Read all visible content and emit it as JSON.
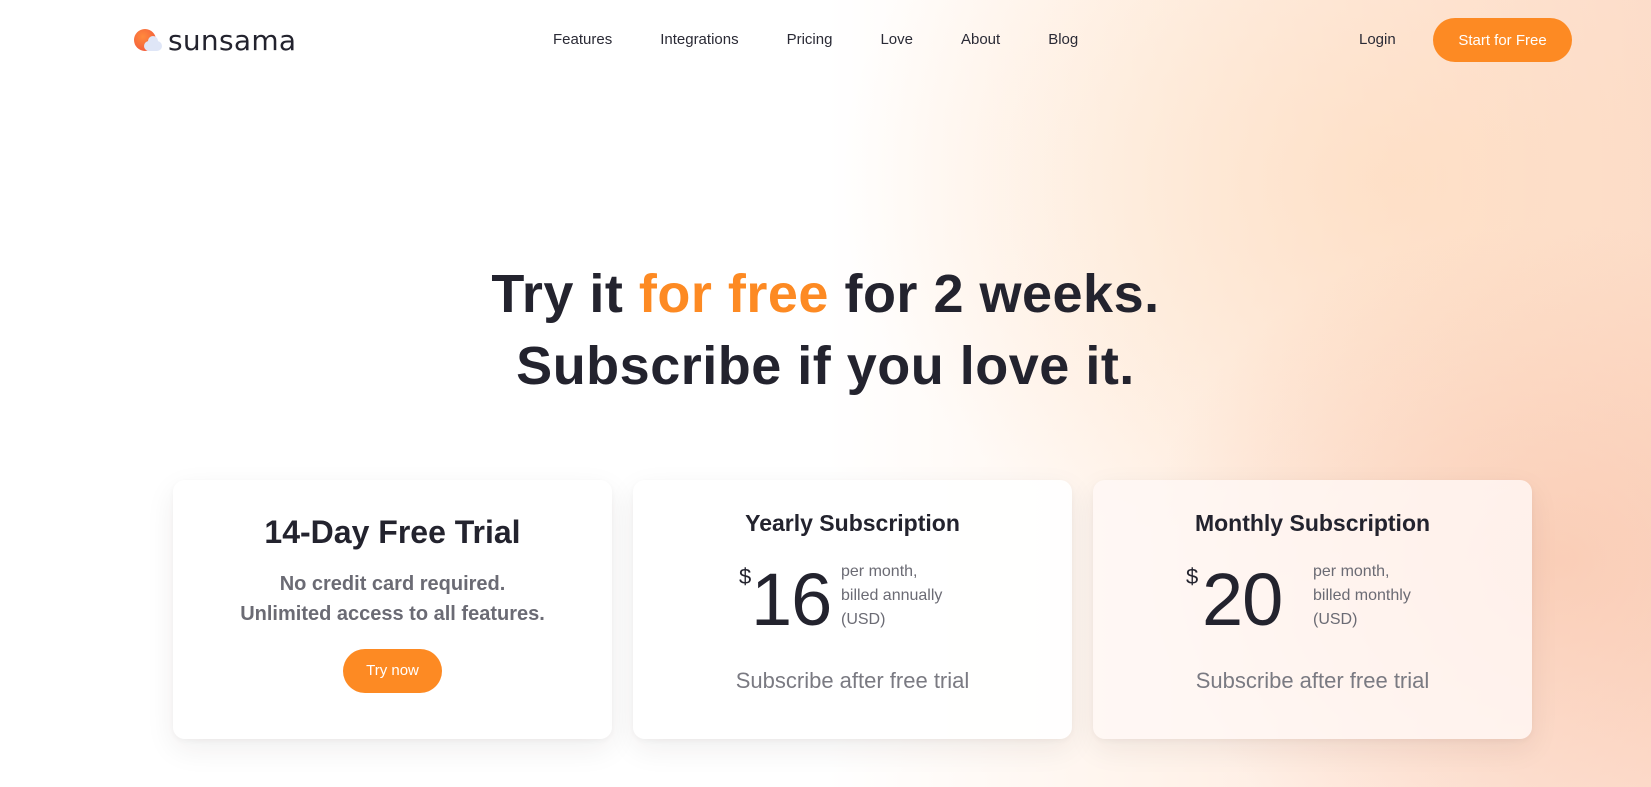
{
  "brand": {
    "name": "sunsama",
    "icon": "sun-cloud-icon"
  },
  "nav": {
    "items": [
      "Features",
      "Integrations",
      "Pricing",
      "Love",
      "About",
      "Blog"
    ],
    "login": "Login",
    "cta": "Start for Free"
  },
  "hero": {
    "line1_prefix": "Try it ",
    "line1_accent": "for free",
    "line1_suffix": " for 2 weeks.",
    "line2": "Subscribe if you love it."
  },
  "trial": {
    "title": "14-Day Free Trial",
    "line1": "No credit card required.",
    "line2": "Unlimited access to all features.",
    "button": "Try now"
  },
  "yearly": {
    "title": "Yearly Subscription",
    "currency": "$",
    "amount": "16",
    "detail1": "per month,",
    "detail2": "billed annually",
    "detail3": "(USD)",
    "note": "Subscribe after free trial"
  },
  "monthly": {
    "title": "Monthly Subscription",
    "currency": "$",
    "amount": "20",
    "detail1": "per month,",
    "detail2": "billed monthly",
    "detail3": "(USD)",
    "note": "Subscribe after free trial"
  },
  "colors": {
    "accent": "#fd8a23",
    "text": "#23232e",
    "muted": "#6b6b74"
  }
}
